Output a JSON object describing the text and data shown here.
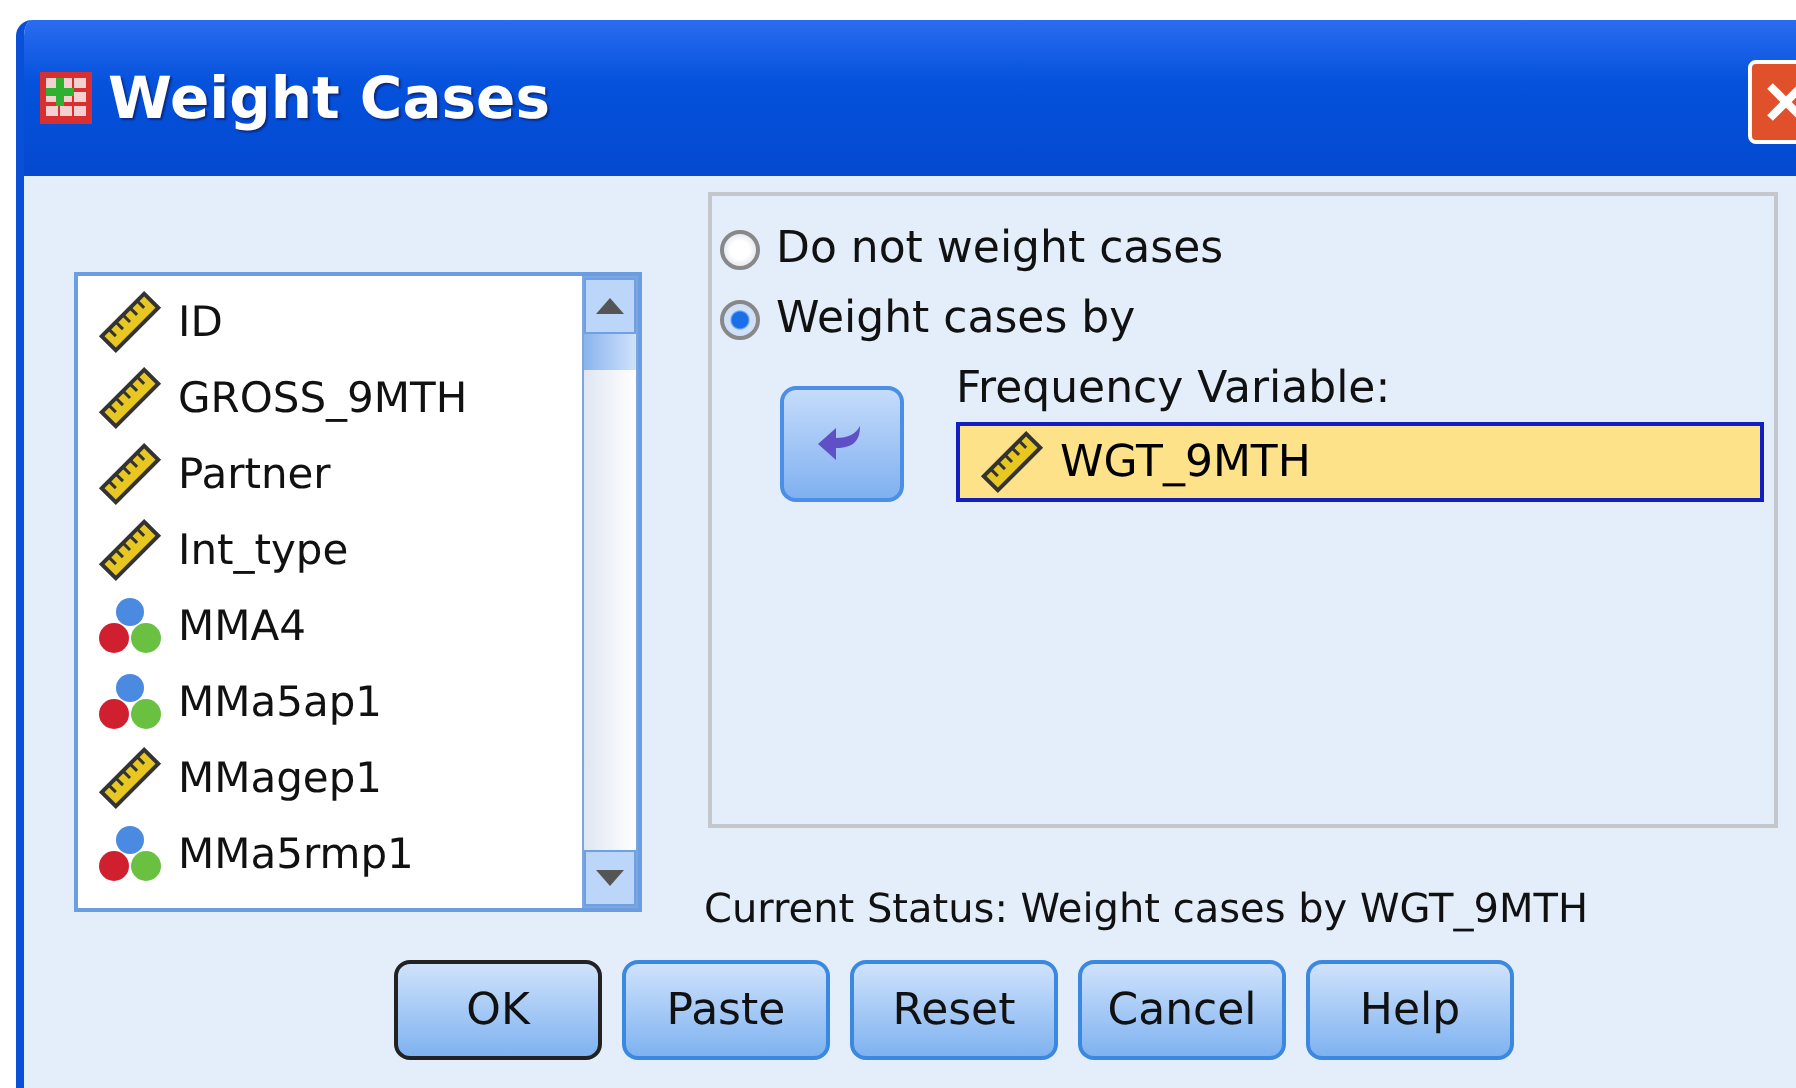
{
  "window": {
    "title": "Weight Cases"
  },
  "variables": [
    {
      "name": "ID",
      "kind": "scale"
    },
    {
      "name": "GROSS_9MTH",
      "kind": "scale"
    },
    {
      "name": "Partner",
      "kind": "scale"
    },
    {
      "name": "Int_type",
      "kind": "scale"
    },
    {
      "name": "MMA4",
      "kind": "nominal"
    },
    {
      "name": "MMa5ap1",
      "kind": "nominal"
    },
    {
      "name": "MMagep1",
      "kind": "scale"
    },
    {
      "name": "MMa5rmp1",
      "kind": "nominal"
    }
  ],
  "options": [
    {
      "label": "Do not weight cases",
      "selected": false
    },
    {
      "label": "Weight cases by",
      "selected": true
    }
  ],
  "frequency_variable": {
    "label": "Frequency Variable:",
    "value": "WGT_9MTH",
    "kind": "scale"
  },
  "status": "Current Status: Weight cases by WGT_9MTH",
  "buttons": [
    {
      "label": "OK",
      "default": true
    },
    {
      "label": "Paste",
      "default": false
    },
    {
      "label": "Reset",
      "default": false
    },
    {
      "label": "Cancel",
      "default": false
    },
    {
      "label": "Help",
      "default": false
    }
  ]
}
